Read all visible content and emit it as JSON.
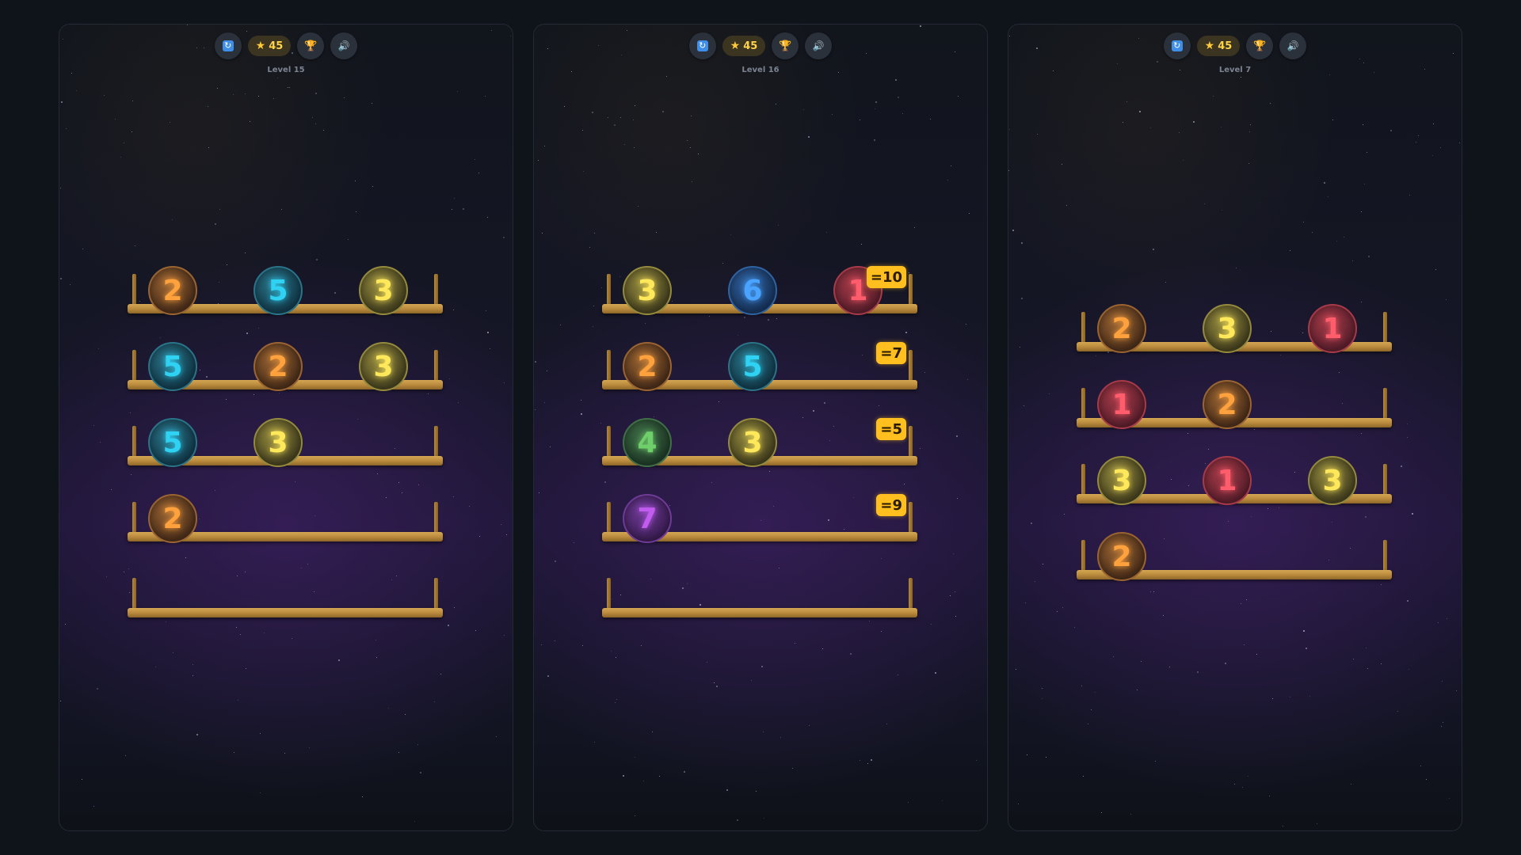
{
  "colors": {
    "1": {
      "fg": "#ff5d6c",
      "bg": "#5a1f2c",
      "border": "#a63a48"
    },
    "2": {
      "fg": "#ffa23d",
      "bg": "#4a2e1a",
      "border": "#9a6432"
    },
    "3": {
      "fg": "#ffe95a",
      "bg": "#45401f",
      "border": "#948a3e"
    },
    "4": {
      "fg": "#6fcf6a",
      "bg": "#1f3a27",
      "border": "#3f6e47"
    },
    "5": {
      "fg": "#2fd2f2",
      "bg": "#123a4a",
      "border": "#2a7388"
    },
    "6": {
      "fg": "#4aa3ff",
      "bg": "#17335a",
      "border": "#2f62a0"
    },
    "7": {
      "fg": "#c25cf0",
      "bg": "#3a1d52",
      "border": "#6e3a96"
    }
  },
  "panels": [
    {
      "topbar": {
        "refresh_icon": "refresh-icon",
        "score": "45",
        "trophy_icon": "trophy-icon",
        "sound_icon": "speaker-icon"
      },
      "level_label": "Level 15",
      "shelves": [
        {
          "balls": [
            "2",
            "5",
            "3"
          ],
          "target": ""
        },
        {
          "balls": [
            "5",
            "2",
            "3"
          ],
          "target": ""
        },
        {
          "balls": [
            "5",
            "3"
          ],
          "target": ""
        },
        {
          "balls": [
            "2"
          ],
          "target": ""
        },
        {
          "balls": [],
          "target": ""
        }
      ]
    },
    {
      "topbar": {
        "refresh_icon": "refresh-icon",
        "score": "45",
        "trophy_icon": "trophy-icon",
        "sound_icon": "speaker-icon"
      },
      "level_label": "Level 16",
      "shelves": [
        {
          "balls": [
            "3",
            "6",
            "1"
          ],
          "target": "=10"
        },
        {
          "balls": [
            "2",
            "5"
          ],
          "target": "=7"
        },
        {
          "balls": [
            "4",
            "3"
          ],
          "target": "=5"
        },
        {
          "balls": [
            "7"
          ],
          "target": "=9"
        },
        {
          "balls": [],
          "target": ""
        }
      ]
    },
    {
      "topbar": {
        "refresh_icon": "refresh-icon",
        "score": "45",
        "trophy_icon": "trophy-icon",
        "sound_icon": "speaker-icon"
      },
      "level_label": "Level 7",
      "shelves": [
        {
          "balls": [
            "2",
            "3",
            "1"
          ],
          "target": ""
        },
        {
          "balls": [
            "1",
            "2"
          ],
          "target": ""
        },
        {
          "balls": [
            "3",
            "1",
            "3"
          ],
          "target": ""
        },
        {
          "balls": [
            "2"
          ],
          "target": ""
        }
      ]
    }
  ]
}
